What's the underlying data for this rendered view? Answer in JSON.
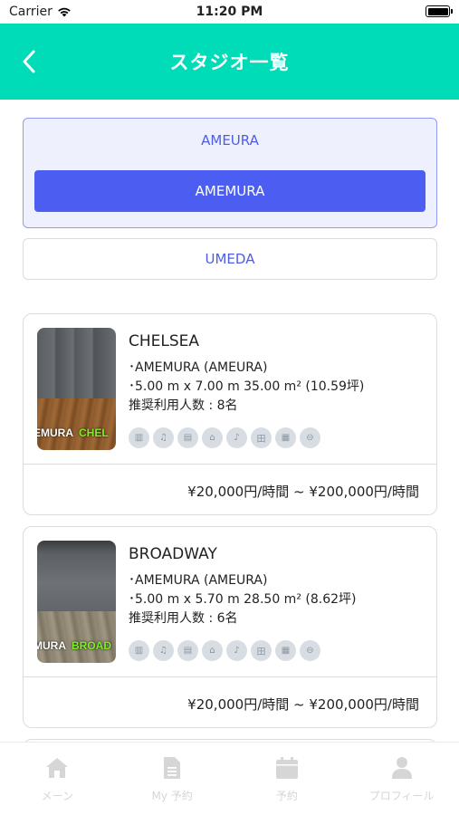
{
  "status_bar": {
    "carrier": "Carrier",
    "time": "11:20 PM"
  },
  "header": {
    "title": "スタジオ一覧"
  },
  "areas": {
    "group_title": "AMEURA",
    "selected_sub_area": "AMEMURA",
    "other_area": "UMEDA"
  },
  "studios": [
    {
      "name": "CHELSEA",
      "location": "･AMEMURA (AMEURA)",
      "size": "･5.00 m x 7.00 m 35.00 m² (10.59坪)",
      "capacity": "推奨利用人数 : 8名",
      "photo_label_1": "EMURA",
      "photo_label_2": "CHEL",
      "price": "¥20,000円/時間 ~ ¥200,000円/時間"
    },
    {
      "name": "BROADWAY",
      "location": "･AMEMURA (AMEURA)",
      "size": "･5.00 m x 5.70 m 28.50 m² (8.62坪)",
      "capacity": "推奨利用人数 : 6名",
      "photo_label_1": "MURA",
      "photo_label_2": "BROAD",
      "price": "¥20,000円/時間 ~ ¥200,000円/時間"
    }
  ],
  "amenity_icons": [
    "mirror-icon",
    "speaker-icon",
    "locker-icon",
    "wifi-icon",
    "audio-icon",
    "table-icon",
    "parking-icon",
    "other-icon"
  ],
  "tab_bar": {
    "home": "メーン",
    "my_reservations": "My 予約",
    "reserve": "予約",
    "profile": "プロフィール"
  },
  "colors": {
    "header": "#00dbb8",
    "accent": "#4c5ef2",
    "accent_text": "#4e5ce8",
    "group_bg": "#eef0fd"
  }
}
